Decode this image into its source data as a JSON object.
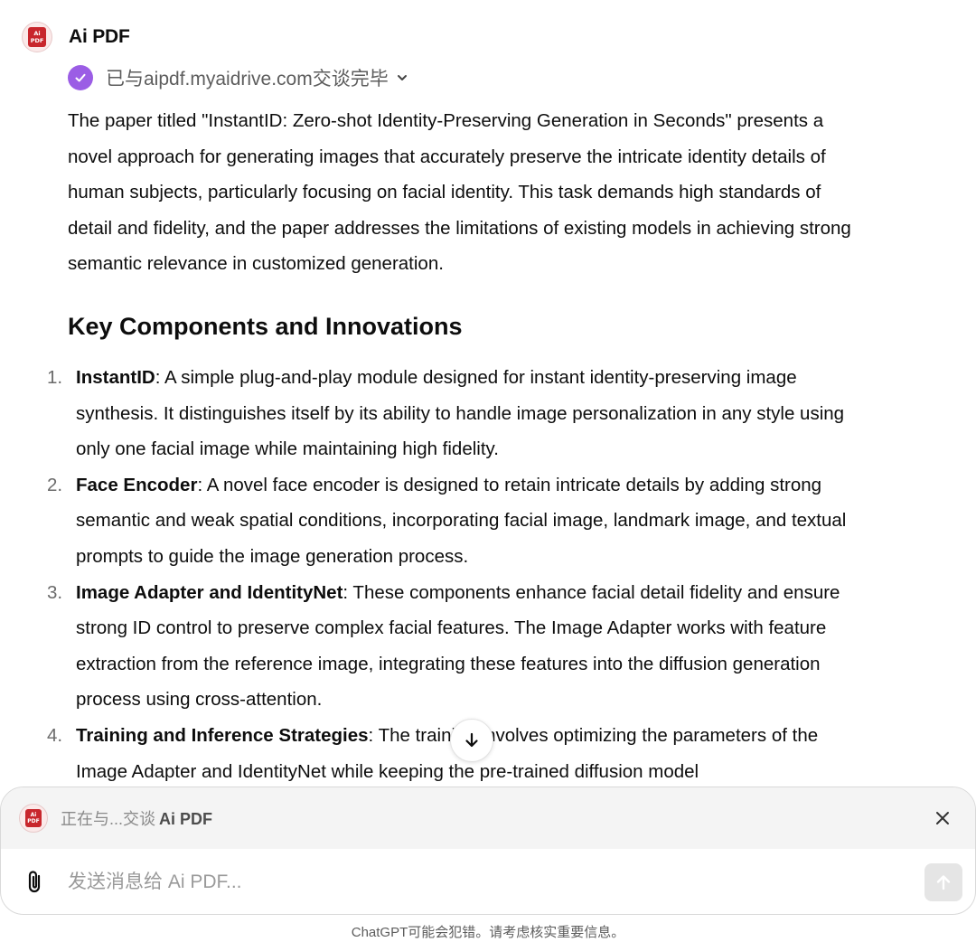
{
  "message": {
    "gpt_name": "Ai PDF",
    "avatar_text": [
      "Ai",
      "PDF"
    ],
    "status_text": "已与aipdf.myaidrive.com交谈完毕",
    "intro": "The paper titled \"InstantID: Zero-shot Identity-Preserving Generation in Seconds\" presents a novel approach for generating images that accurately preserve the intricate identity details of human subjects, particularly focusing on facial identity. This task demands high standards of detail and fidelity, and the paper addresses the limitations of existing models in achieving strong semantic relevance in customized generation.",
    "heading": "Key Components and Innovations",
    "items": [
      {
        "num": "1.",
        "term": "InstantID",
        "text": ": A simple plug-and-play module designed for instant identity-preserving image synthesis. It distinguishes itself by its ability to handle image personalization in any style using only one facial image while maintaining high fidelity."
      },
      {
        "num": "2.",
        "term": "Face Encoder",
        "text": ": A novel face encoder is designed to retain intricate details by adding strong semantic and weak spatial conditions, incorporating facial image, landmark image, and textual prompts to guide the image generation process."
      },
      {
        "num": "3.",
        "term": "Image Adapter and IdentityNet",
        "text": ": These components enhance facial detail fidelity and ensure strong ID control to preserve complex facial features. The Image Adapter works with feature extraction from the reference image, integrating these features into the diffusion generation process using cross-attention."
      },
      {
        "num": "4.",
        "term": "Training and Inference Strategies",
        "text": ": The training involves optimizing the parameters of the Image Adapter and IdentityNet while keeping the pre-trained diffusion model"
      }
    ]
  },
  "composer": {
    "talking_prefix": "正在与...交谈",
    "talking_name": "Ai PDF",
    "placeholder": "发送消息给 Ai PDF..."
  },
  "footer": {
    "disclaimer": "ChatGPT可能会犯错。请考虑核实重要信息。"
  },
  "colors": {
    "check_badge": "#9b5de5",
    "pdf_red": "#c8262c",
    "text": "#0d0d0d",
    "muted": "#5d5d5d"
  },
  "icons": [
    "pdf-avatar-icon",
    "check-circle-icon",
    "chevron-down-icon",
    "arrow-down-icon",
    "close-icon",
    "paperclip-icon",
    "arrow-up-icon"
  ]
}
